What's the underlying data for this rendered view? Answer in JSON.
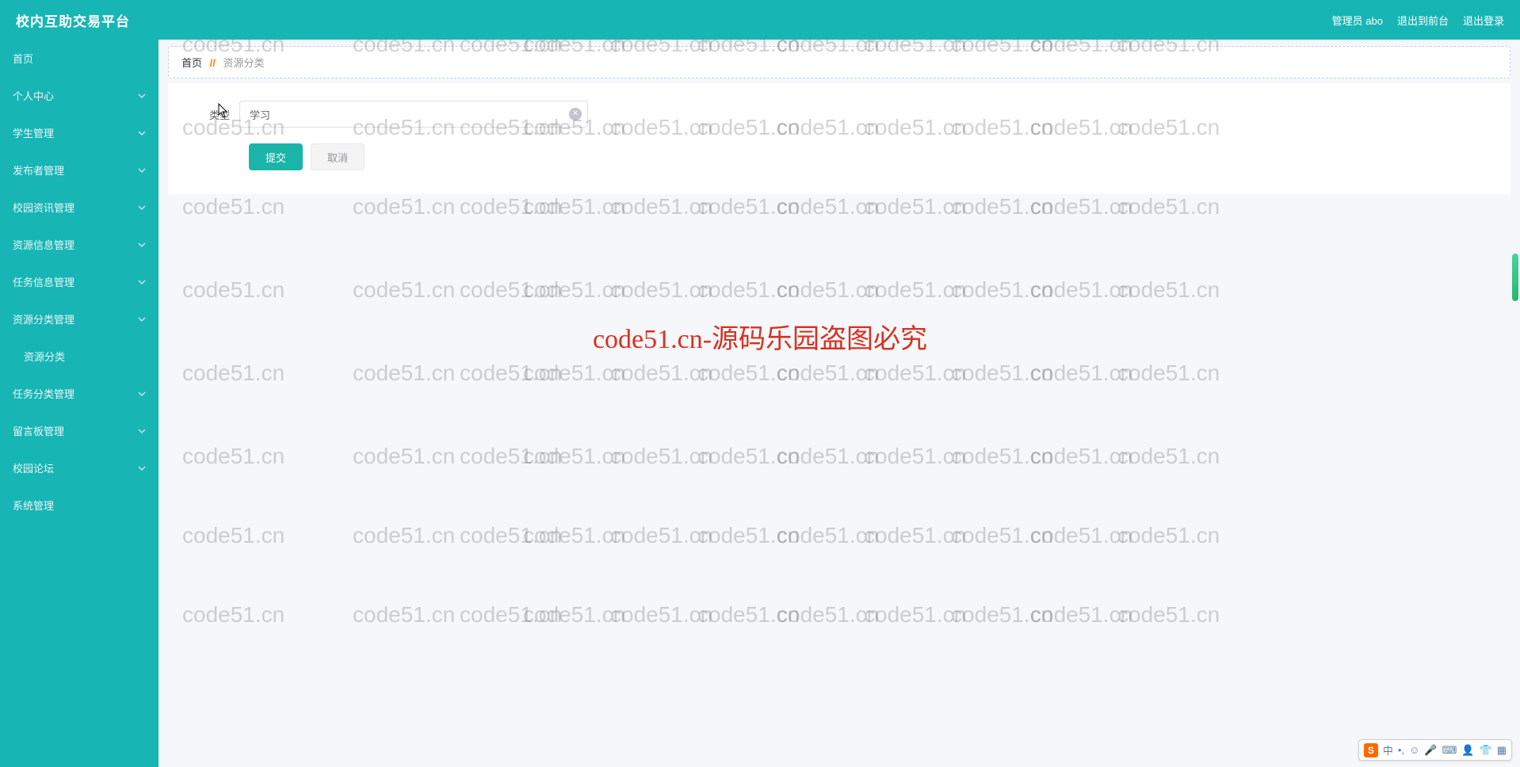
{
  "header": {
    "title": "校内互助交易平台",
    "admin_label": "管理员 abo",
    "exit_front_label": "退出到前台",
    "logout_label": "退出登录"
  },
  "sidebar": {
    "items": [
      {
        "label": "首页",
        "expandable": false
      },
      {
        "label": "个人中心",
        "expandable": true
      },
      {
        "label": "学生管理",
        "expandable": true
      },
      {
        "label": "发布者管理",
        "expandable": true
      },
      {
        "label": "校园资讯管理",
        "expandable": true
      },
      {
        "label": "资源信息管理",
        "expandable": true
      },
      {
        "label": "任务信息管理",
        "expandable": true
      },
      {
        "label": "资源分类管理",
        "expandable": true,
        "expanded": true,
        "children": [
          {
            "label": "资源分类"
          }
        ]
      },
      {
        "label": "任务分类管理",
        "expandable": true
      },
      {
        "label": "留言板管理",
        "expandable": true
      },
      {
        "label": "校园论坛",
        "expandable": true
      },
      {
        "label": "系统管理",
        "expandable": true
      }
    ]
  },
  "breadcrumb": {
    "home": "首页",
    "separator": "//",
    "current": "资源分类"
  },
  "form": {
    "type_label": "类型",
    "type_value": "学习",
    "submit_label": "提交",
    "cancel_label": "取消"
  },
  "watermark": {
    "text": "code51.cn",
    "center_text": "code51.cn-源码乐园盗图必究",
    "rows": [
      40,
      145,
      245,
      350,
      455,
      560,
      660,
      760
    ],
    "cols": [
      10,
      230,
      445,
      580,
      660,
      770,
      880,
      980,
      1090,
      1200,
      1300,
      1410
    ]
  },
  "ime": {
    "logo": "S",
    "lang": "中",
    "icons": [
      "punct",
      "emoji",
      "mic",
      "keyboard",
      "person",
      "shirt",
      "grid"
    ]
  }
}
